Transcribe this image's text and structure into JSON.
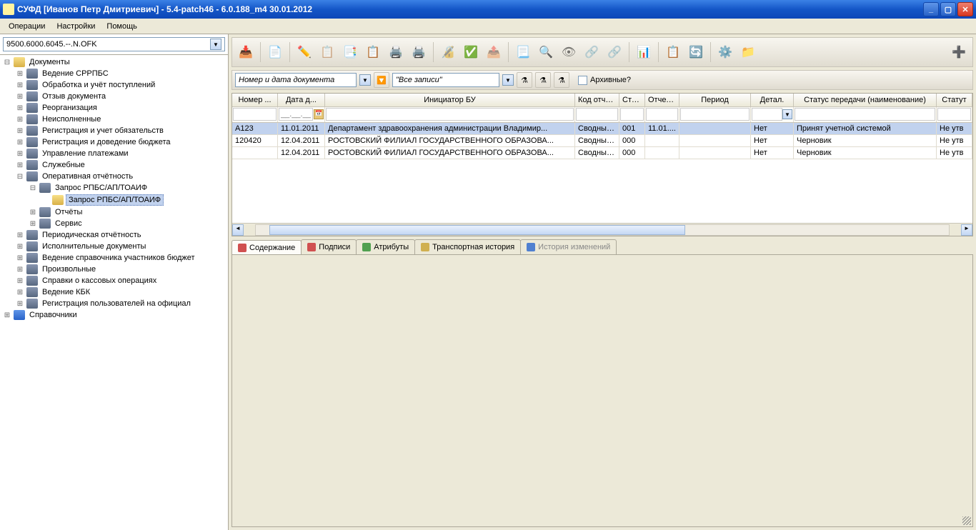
{
  "titlebar": {
    "title": "СУФД [Иванов Петр Дмитриевич] - 5.4-patch46 - 6.0.188_m4 30.01.2012"
  },
  "menu": {
    "operations": "Операции",
    "settings": "Настройки",
    "help": "Помощь"
  },
  "sidebar": {
    "selector": "9500.6000.6045.--.N.OFK",
    "root": "Документы",
    "items": [
      "Ведение СРРПБС",
      "Обработка и учёт поступлений",
      "Отзыв документа",
      "Реорганизация",
      "Неисполненные",
      "Регистрация и учет обязательств",
      "Регистрация и доведение бюджета",
      "Управление платежами",
      "Служебные"
    ],
    "operative": "Оперативная отчётность",
    "operative_sub1": "Запрос РПБС/АП/ТОАИФ",
    "operative_sub2": "Запрос РПБС/АП/ТОАИФ",
    "operative_sub3": "Отчёты",
    "operative_sub4": "Сервис",
    "items2": [
      "Периодическая отчётность",
      "Исполнительные документы",
      "Ведение справочника участников бюджет",
      "Произвольные",
      "Справки о кассовых операциях",
      "Ведение КБК",
      "Регистрация пользователей на официал"
    ],
    "ref": "Справочники"
  },
  "filter": {
    "selector_label": "Номер и дата документа",
    "all_records": "\"Все записи\"",
    "archive": "Архивные?"
  },
  "grid": {
    "headers": {
      "num": "Номер ...",
      "date": "Дата д...",
      "initiator": "Инициатор БУ",
      "code": "Код отчёт...",
      "sta": "Ста...",
      "otch": "Отчетн...",
      "period": "Период",
      "detail": "Детал.",
      "status": "Статус передачи (наименование)",
      "statut": "Статут"
    },
    "date_mask": "__.__.____",
    "rows": [
      {
        "num": "А123",
        "date": "11.01.2011",
        "init": "Департамент здравоохранения администрации Владимир...",
        "code": "Сводные ...",
        "sta": "001",
        "otch": "11.01....",
        "period": "",
        "detail": "Нет",
        "status": "Принят учетной системой",
        "statut": "Не утв"
      },
      {
        "num": "120420",
        "date": "12.04.2011",
        "init": "РОСТОВСКИЙ ФИЛИАЛ ГОСУДАРСТВЕННОГО ОБРАЗОВА...",
        "code": "Сводные ...",
        "sta": "000",
        "otch": "",
        "period": "",
        "detail": "Нет",
        "status": "Черновик",
        "statut": "Не утв"
      },
      {
        "num": "",
        "date": "12.04.2011",
        "init": "РОСТОВСКИЙ ФИЛИАЛ ГОСУДАРСТВЕННОГО ОБРАЗОВА...",
        "code": "Сводные ...",
        "sta": "000",
        "otch": "",
        "period": "",
        "detail": "Нет",
        "status": "Черновик",
        "statut": "Не утв"
      }
    ]
  },
  "tabs": {
    "content": "Содержание",
    "signatures": "Подписи",
    "attributes": "Атрибуты",
    "transport": "Транспортная история",
    "history": "История изменений"
  }
}
